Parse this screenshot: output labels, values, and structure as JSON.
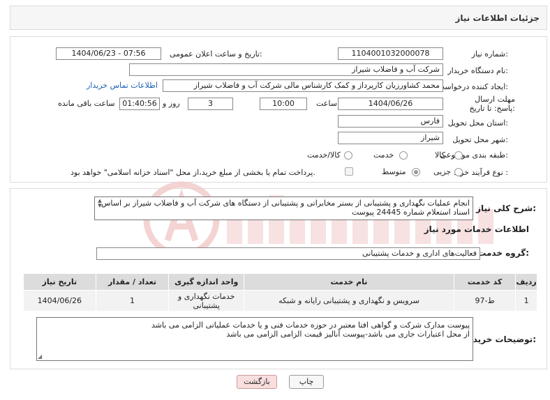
{
  "header": {
    "title": "جزئیات اطلاعات نیاز"
  },
  "fields": {
    "need_number_label": "شماره نیاز:",
    "need_number": "1104001032000078",
    "announce_label": "تاریخ و ساعت اعلان عمومی:",
    "announce_value": "1404/06/23 - 07:56",
    "buyer_org_label": "نام دستگاه خریدار:",
    "buyer_org": "شرکت آب و فاضلاب شیراز",
    "requester_label": "ایجاد کننده درخواست:",
    "requester": "محمد کشاورزیان کارپرداز و کمک کارشناس مالی شرکت آب و فاضلاب شیراز",
    "contact_link": "اطلاعات تماس خریدار",
    "deadline_label": "مهلت ارسال پاسخ: تا تاریخ:",
    "deadline_date": "1404/06/26",
    "time_label": "ساعت",
    "deadline_time": "10:00",
    "days_value": "3",
    "days_label": "روز و",
    "remaining_time": "01:40:56",
    "remaining_label": "ساعت باقی مانده",
    "province_label": "استان محل تحویل:",
    "province": "فارس",
    "city_label": "شهر محل تحویل:",
    "city": "شیراز",
    "category_label": "طبقه بندی موضوعی:",
    "category_options": [
      "کالا",
      "خدمت",
      "کالا/خدمت"
    ],
    "process_label": "نوع فرآیند خرید :",
    "process_options": [
      "جزیی",
      "متوسط"
    ],
    "payment_note": "پرداخت تمام یا بخشی از مبلغ خرید،از محل \"اسناد خزانه اسلامی\" خواهد بود."
  },
  "description": {
    "label": "شرح کلی نیاز:",
    "text": "انجام عملیات نگهداری و پشتیبانی از بستر مخابراتی و پشتیبانی از دستگاه های شرکت آب و فاضلاب شیراز بر اساس اسناد استعلام شماره 24445 پیوست"
  },
  "services": {
    "section_title": "اطلاعات خدمات مورد نیاز",
    "group_label": "گروه خدمت:",
    "group_value": "فعالیت‌های اداری و خدمات پشتیبانی",
    "columns": [
      "ردیف",
      "کد خدمت",
      "نام خدمت",
      "واحد اندازه گیری",
      "تعداد / مقدار",
      "تاریخ نیاز"
    ],
    "rows": [
      {
        "row": "1",
        "code": "ط-97",
        "name": "سرویس و نگهداری و پشتیبانی رایانه و شبکه",
        "unit": "خدمات نگهداری و پشتیبانی",
        "qty": "1",
        "date": "1404/06/26"
      }
    ]
  },
  "buyer_notes": {
    "label": "توضیحات خریدار:",
    "line1": "پیوست مدارک شرکت و گواهی افتا معتبر در حوزه خدمات فنی و یا خدمات عملیاتی الزامی می باشد",
    "line2": "از محل اعتبارات جاری می باشد-پیوست آنالیز قیمت الزامی الزامی می باشد"
  },
  "buttons": {
    "print": "چاپ",
    "back": "بازگشت"
  },
  "colors": {
    "accent": "#1a5fb4",
    "back_button": "#f9dede",
    "header_bg": "#f6f6f6"
  }
}
